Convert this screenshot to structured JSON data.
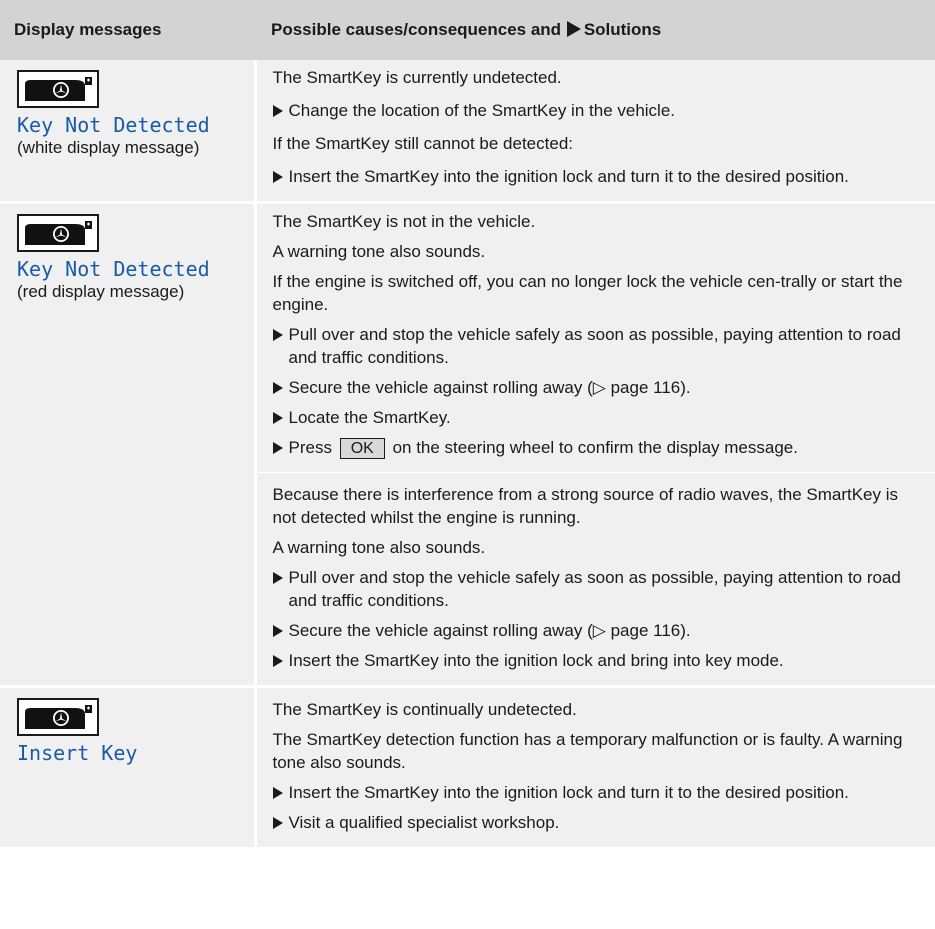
{
  "header": {
    "col1": "Display messages",
    "col2_text": "Possible causes/consequences and",
    "col2_suffix": "Solutions"
  },
  "icon": "smartkey-icon",
  "colors": {
    "display_text": "#1a5aa6",
    "header_bg": "#d3d3d3",
    "cell_bg": "#f0f0f0"
  },
  "rows": [
    {
      "message": "Key Not Detected",
      "note": "(white display message)",
      "p1": "The SmartKey is currently undetected.",
      "s1": "Change the location of the SmartKey in the vehicle.",
      "p2": "If the SmartKey still cannot be detected:",
      "s2": "Insert the SmartKey into the ignition lock and turn it to the desired position."
    },
    {
      "message": "Key Not Detected",
      "note": "(red display message)",
      "p1": "The SmartKey is not in the vehicle.",
      "p2": "A warning tone also sounds.",
      "p3": "If the engine is switched off, you can no longer lock the vehicle cen-trally or start the engine.",
      "s1": "Pull over and stop the vehicle safely as soon as possible, paying attention to road and traffic conditions.",
      "s2_a": "Secure the vehicle against rolling away (",
      "s2_ref": "▷ page 116",
      "s2_b": ").",
      "s3": "Locate the SmartKey.",
      "s4_a": "Press",
      "s4_btn": "OK",
      "s4_b": "on the steering wheel to confirm the display message."
    },
    {
      "p1": "Because there is interference from a strong source of radio waves, the SmartKey is not detected whilst the engine is running.",
      "p2": "A warning tone also sounds.",
      "s1": "Pull over and stop the vehicle safely as soon as possible, paying attention to road and traffic conditions.",
      "s2_a": "Secure the vehicle against rolling away (",
      "s2_ref": "▷ page 116",
      "s2_b": ").",
      "s3": "Insert the SmartKey into the ignition lock and bring into key mode."
    },
    {
      "message": "Insert Key",
      "p1": "The SmartKey is continually undetected.",
      "p2": "The SmartKey detection function has a temporary malfunction or is faulty. A warning tone also sounds.",
      "s1": "Insert the SmartKey into the ignition lock and turn it to the desired position.",
      "s2": "Visit a qualified specialist workshop."
    }
  ]
}
